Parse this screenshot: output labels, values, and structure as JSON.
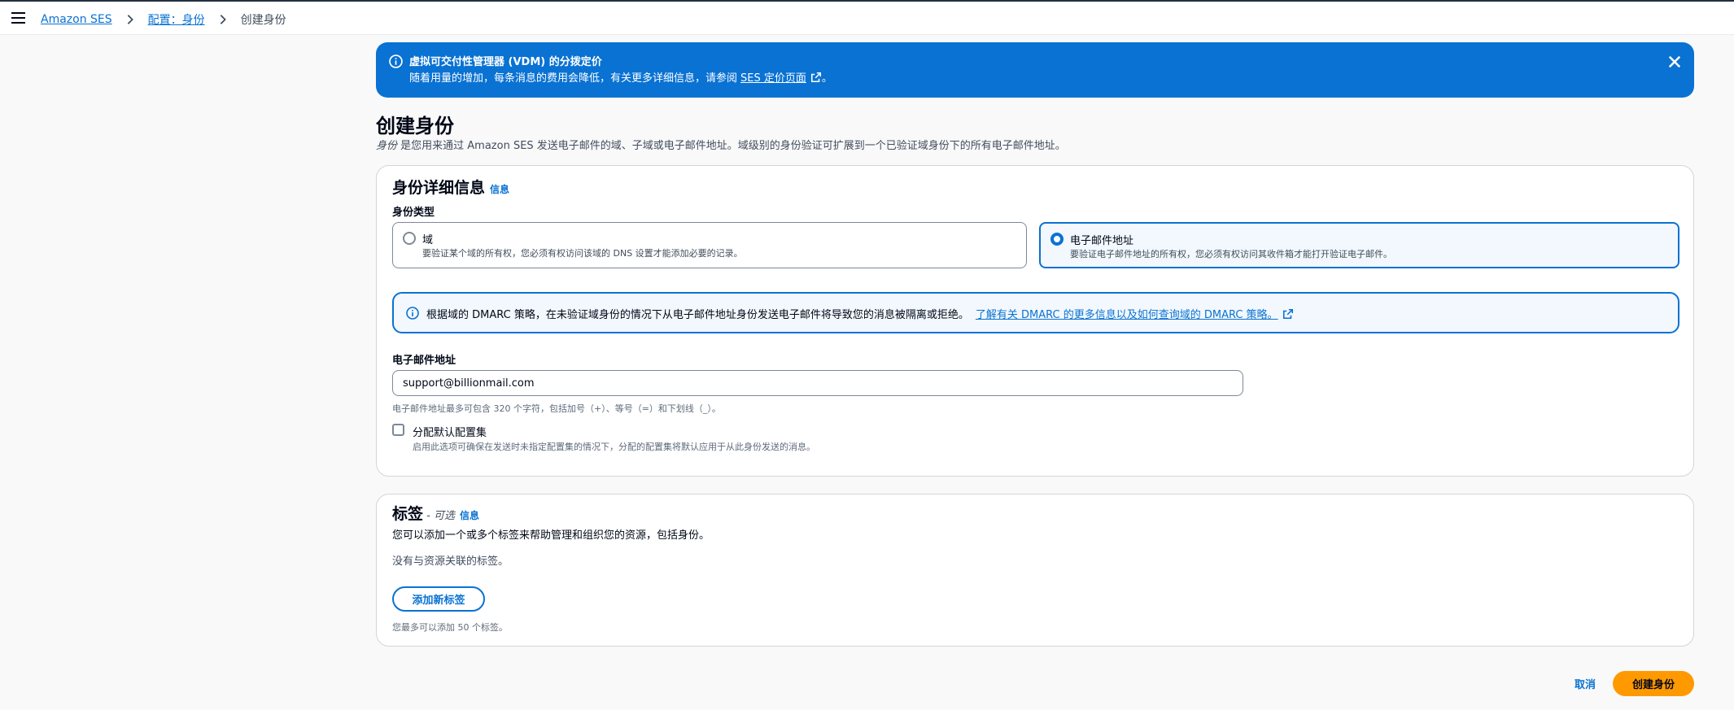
{
  "breadcrumb": {
    "items": [
      "Amazon SES",
      "配置：身份",
      "创建身份"
    ]
  },
  "flash": {
    "title": "虚拟可交付性管理器 (VDM) 的分拨定价",
    "text": "随着用量的增加，每条消息的费用会降低，有关更多详细信息，请参阅",
    "link": "SES 定价页面",
    "text_end": "。"
  },
  "page": {
    "title": "创建身份",
    "desc_em": "身份",
    "desc": " 是您用来通过 Amazon SES 发送电子邮件的域、子域或电子邮件地址。域级别的身份验证可扩展到一个已验证域身份下的所有电子邮件地址。"
  },
  "details": {
    "title": "身份详细信息",
    "info": "信息",
    "type_label": "身份类型",
    "options": [
      {
        "title": "域",
        "desc": "要验证某个域的所有权，您必须有权访问该域的 DNS 设置才能添加必要的记录。",
        "selected": false
      },
      {
        "title": "电子邮件地址",
        "desc": "要验证电子邮件地址的所有权，您必须有权访问其收件箱才能打开验证电子邮件。",
        "selected": true
      }
    ],
    "alert_text": "根据域的 DMARC 策略，在未验证域身份的情况下从电子邮件地址身份发送电子邮件将导致您的消息被隔离或拒绝。",
    "alert_link": "了解有关 DMARC 的更多信息以及如何查询域的 DMARC 策略。",
    "email_label": "电子邮件地址",
    "email_value": "support@billionmail.com",
    "email_hint": "电子邮件地址最多可包含 320 个字符，包括加号（+）、等号（=）和下划线（_）。",
    "config_set_label": "分配默认配置集",
    "config_set_desc": "启用此选项可确保在发送时未指定配置集的情况下，分配的配置集将默认应用于从此身份发送的消息。"
  },
  "tags": {
    "title": "标签",
    "optional": " - 可选",
    "info": "信息",
    "desc": "您可以添加一个或多个标签来帮助管理和组织您的资源，包括身份。",
    "empty": "没有与资源关联的标签。",
    "add_button": "添加新标签",
    "limit": "您最多可以添加 50 个标签。"
  },
  "actions": {
    "cancel": "取消",
    "create": "创建身份"
  },
  "colors": {
    "accent": "#0972d3",
    "primary_button": "#ff9900"
  }
}
